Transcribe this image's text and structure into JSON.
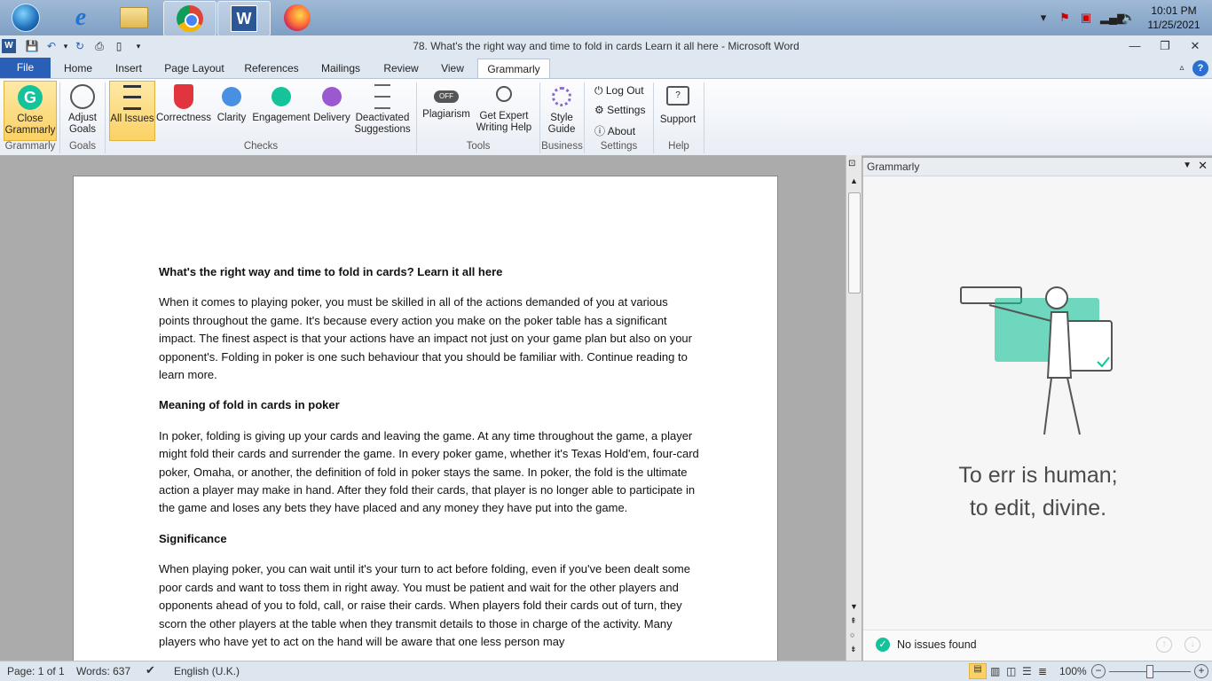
{
  "taskbar": {
    "clock_time": "10:01 PM",
    "clock_date": "11/25/2021"
  },
  "window": {
    "title": "78. What's the right way and time to fold in cards Learn it all here  -  Microsoft Word"
  },
  "tabs": [
    "File",
    "Home",
    "Insert",
    "Page Layout",
    "References",
    "Mailings",
    "Review",
    "View",
    "Grammarly"
  ],
  "ribbon": {
    "close_grammarly_1": "Close",
    "close_grammarly_2": "Grammarly",
    "adjust_goals_1": "Adjust",
    "adjust_goals_2": "Goals",
    "all_issues": "All Issues",
    "correctness": "Correctness",
    "clarity": "Clarity",
    "engagement": "Engagement",
    "delivery": "Delivery",
    "deactivated_1": "Deactivated",
    "deactivated_2": "Suggestions",
    "plagiarism": "Plagiarism",
    "expert_1": "Get Expert",
    "expert_2": "Writing Help",
    "style_1": "Style",
    "style_2": "Guide",
    "log_out": "Log Out",
    "settings": "Settings",
    "about": "About",
    "support": "Support",
    "groups": {
      "grammarly": "Grammarly",
      "goals": "Goals",
      "checks": "Checks",
      "tools": "Tools",
      "business": "Business",
      "settings": "Settings",
      "help": "Help"
    }
  },
  "document": {
    "heading1": "What's the right way and time to fold in cards? Learn it all here",
    "para1": "When it comes to playing poker, you must be skilled in all of the actions demanded of you at various points throughout the game. It's because every action you make on the poker table has a significant impact. The finest aspect is that your actions have an impact not just on your game plan but also on your opponent's. Folding in poker is one such behaviour that you should be familiar with. Continue reading to learn more.",
    "heading2": "Meaning of fold in cards in poker",
    "para2": "In poker, folding is giving up your cards and leaving the game. At any time throughout the game, a player might fold their cards and surrender the game. In every poker game, whether it's Texas Hold'em, four-card poker, Omaha, or another, the definition of fold in poker stays the same. In poker, the fold is the ultimate action a player may make in hand. After they fold their cards, that player is no longer able to participate in the game and loses any bets they have placed and any money they have put into the game.",
    "heading3": "Significance",
    "para3": "When playing poker, you can wait until it's your turn to act before folding, even if you've been dealt some poor cards and want to toss them in right away. You must be patient and wait for the other players and opponents ahead of you to fold, call, or raise their cards. When players fold their cards out of turn, they scorn the other players at the table when they transmit details to those in charge of the activity. Many players who have yet to act on the hand will be aware that one less person may"
  },
  "pane": {
    "title": "Grammarly",
    "quote_line1": "To err is human;",
    "quote_line2": "to edit, divine.",
    "no_issues": "No issues found",
    "accent": "#15c39a"
  },
  "statusbar": {
    "page": "Page: 1 of 1",
    "words": "Words: 637",
    "language": "English (U.K.)",
    "zoom": "100%"
  }
}
